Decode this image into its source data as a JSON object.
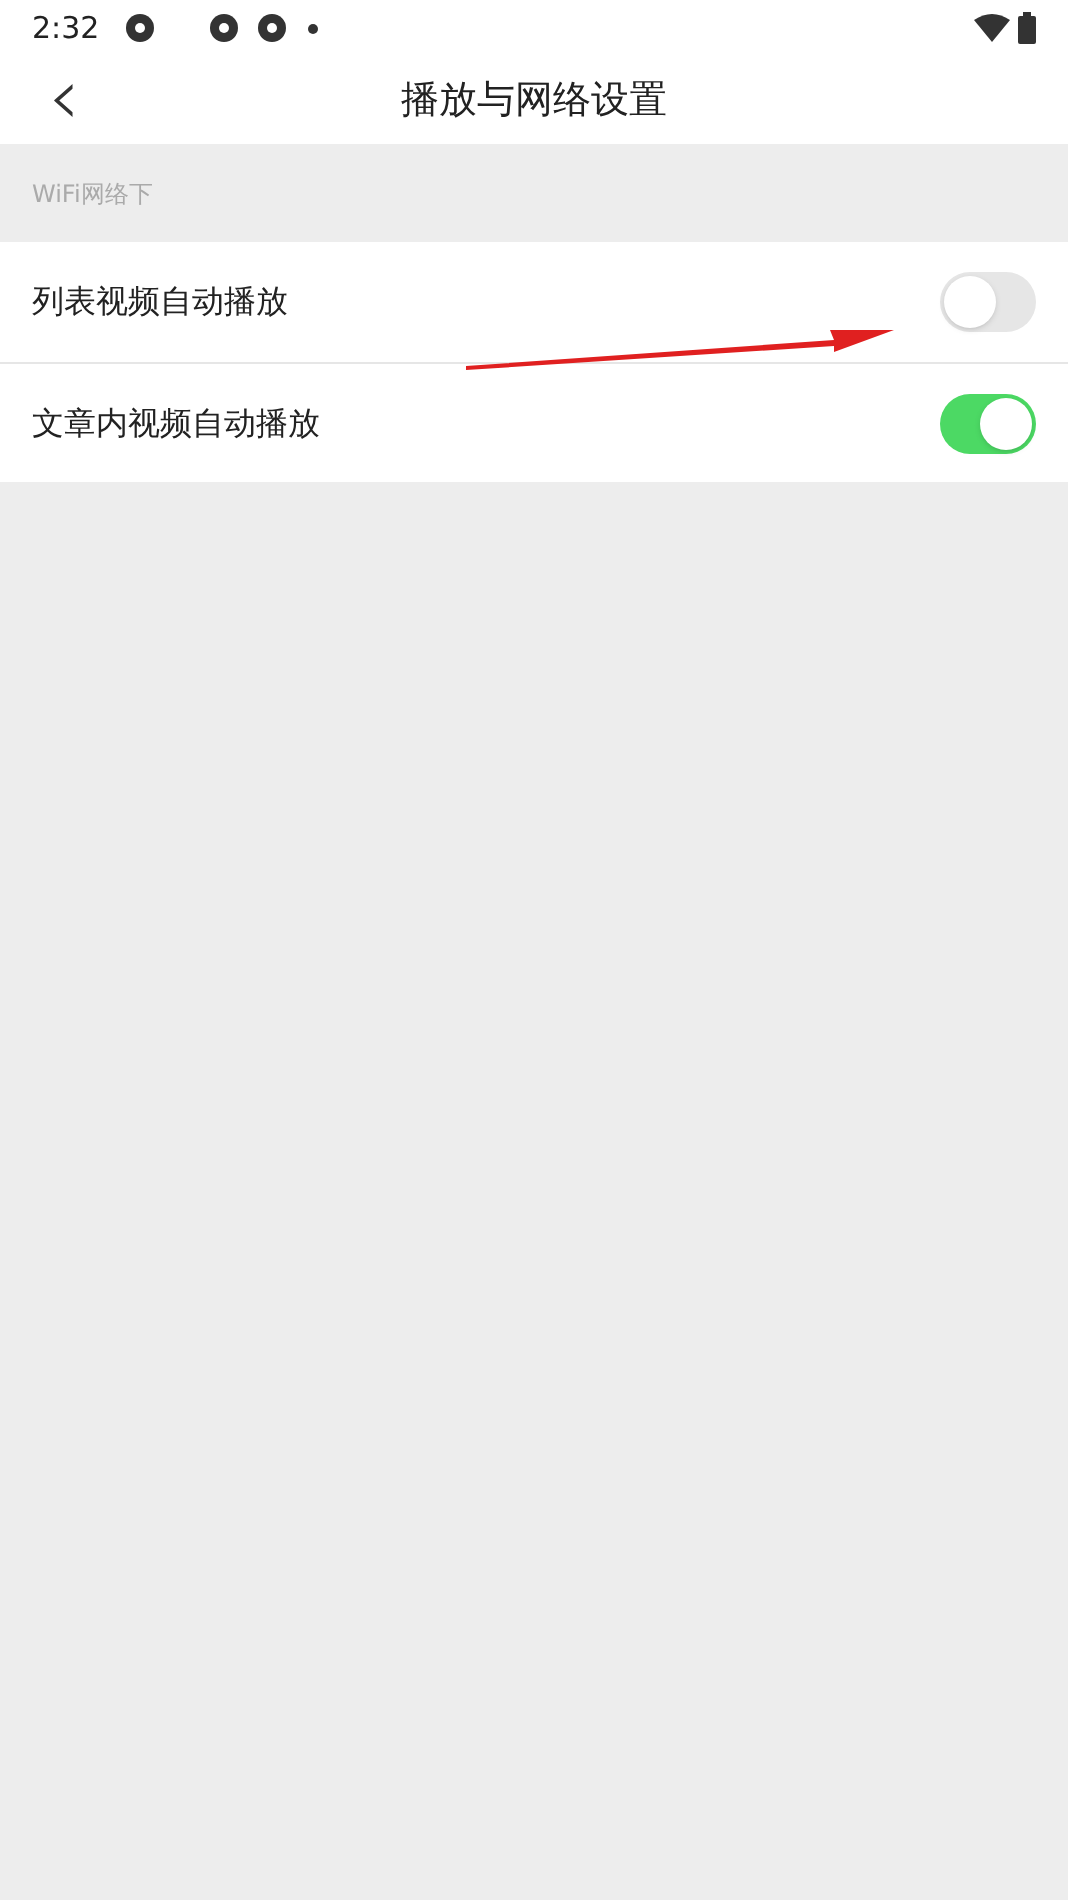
{
  "status_bar": {
    "time": "2:32"
  },
  "header": {
    "back": "‹",
    "title": "播放与网络设置"
  },
  "section": {
    "title": "WiFi网络下"
  },
  "settings": [
    {
      "label": "列表视频自动播放",
      "on": false
    },
    {
      "label": "文章内视频自动播放",
      "on": true
    }
  ]
}
